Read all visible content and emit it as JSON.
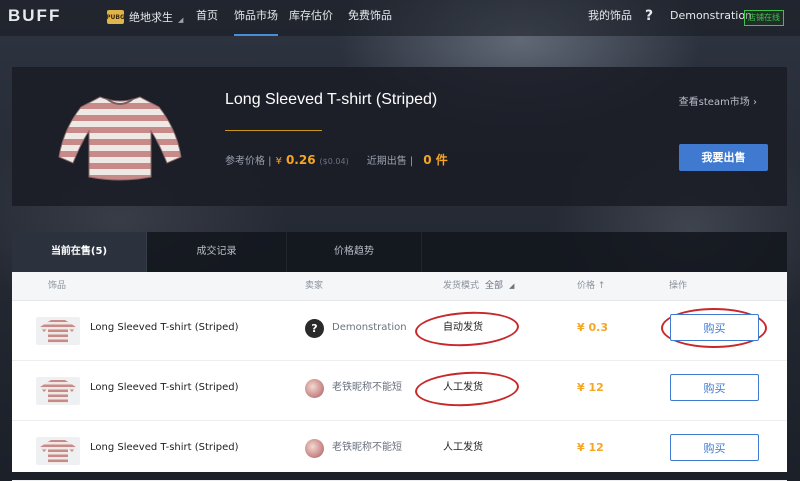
{
  "nav": {
    "logo": "BUFF",
    "game_badge": "PUBG",
    "game": "绝地求生",
    "links": [
      "首页",
      "饰品市场",
      "库存估价",
      "免费饰品"
    ],
    "my_items": "我的饰品",
    "help": "?",
    "username": "Demonstration",
    "status_badge": "店铺在线"
  },
  "item": {
    "title": "Long Sleeved T-shirt (Striped)",
    "steam_link": "查看steam市场 ›",
    "ref_price_label": "参考价格 |",
    "ref_price_currency": "¥",
    "ref_price_value": "0.26",
    "ref_price_usd": "($0.04)",
    "recent_sold_label": "近期出售 |",
    "recent_sold_value": "0 件",
    "sell_button": "我要出售"
  },
  "tabs": [
    "当前在售(5)",
    "成交记录",
    "价格趋势"
  ],
  "table": {
    "headers": {
      "item": "饰品",
      "seller": "卖家",
      "delivery": "发货模式",
      "delivery_filter": "全部",
      "price": "价格 ↑",
      "action": "操作"
    },
    "rows": [
      {
        "name": "Long Sleeved T-shirt (Striped)",
        "seller": "Demonstration",
        "delivery": "自动发货",
        "price": "¥ 0.3",
        "button": "购买"
      },
      {
        "name": "Long Sleeved T-shirt (Striped)",
        "seller": "老铁昵称不能短",
        "delivery": "人工发货",
        "price": "¥ 12",
        "button": "购买"
      },
      {
        "name": "Long Sleeved T-shirt (Striped)",
        "seller": "老铁昵称不能短",
        "delivery": "人工发货",
        "price": "¥ 12",
        "button": "购买"
      }
    ]
  },
  "colors": {
    "accent": "#3f7ad0",
    "price": "#f5a623",
    "annotation": "#c8282a",
    "online": "#3ec24c"
  }
}
